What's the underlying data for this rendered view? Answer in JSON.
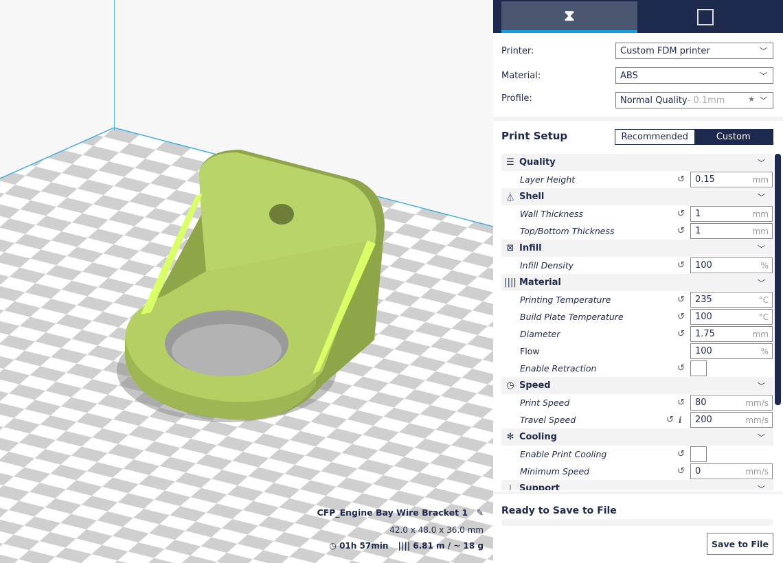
{
  "viewport": {
    "object_name": "CFP_Engine Bay Wire Bracket 1",
    "dimensions": "42.0 x 48.0 x 36.0 mm",
    "print_time": "01h 57min",
    "material_usage": "6.81 m / ~ 18 g",
    "model_color": "#b9d468"
  },
  "tabs": [
    {
      "icon": "slice-settings-icon",
      "active": true
    },
    {
      "icon": "printer-monitor-icon",
      "active": false
    }
  ],
  "machine": {
    "printer_label": "Printer:",
    "printer_value": "Custom FDM printer",
    "material_label": "Material:",
    "material_value": "ABS",
    "profile_label": "Profile:",
    "profile_value": "Normal Quality",
    "profile_suffix": " - 0.1mm"
  },
  "print_setup": {
    "title": "Print Setup",
    "mode_recommended": "Recommended",
    "mode_custom": "Custom",
    "active_mode": "Custom"
  },
  "categories": [
    {
      "label": "Quality",
      "icon": "quality-icon",
      "settings": [
        {
          "label": "Layer Height",
          "value": "0.15",
          "unit": "mm"
        }
      ]
    },
    {
      "label": "Shell",
      "icon": "shell-icon",
      "settings": [
        {
          "label": "Wall Thickness",
          "value": "1",
          "unit": "mm"
        },
        {
          "label": "Top/Bottom Thickness",
          "value": "1",
          "unit": "mm"
        }
      ]
    },
    {
      "label": "Infill",
      "icon": "infill-icon",
      "settings": [
        {
          "label": "Infill Density",
          "value": "100",
          "unit": "%"
        }
      ]
    },
    {
      "label": "Material",
      "icon": "material-icon",
      "settings": [
        {
          "label": "Printing Temperature",
          "value": "235",
          "unit": "°C"
        },
        {
          "label": "Build Plate Temperature",
          "value": "100",
          "unit": "°C"
        },
        {
          "label": "Diameter",
          "value": "1.75",
          "unit": "mm"
        },
        {
          "label": "Flow",
          "value": "100",
          "unit": "%"
        },
        {
          "label": "Enable Retraction",
          "checked": false
        }
      ]
    },
    {
      "label": "Speed",
      "icon": "speed-icon",
      "settings": [
        {
          "label": "Print Speed",
          "value": "80",
          "unit": "mm/s"
        },
        {
          "label": "Travel Speed",
          "value": "200",
          "unit": "mm/s"
        }
      ]
    },
    {
      "label": "Cooling",
      "icon": "cooling-icon",
      "settings": [
        {
          "label": "Enable Print Cooling",
          "checked": false
        },
        {
          "label": "Minimum Speed",
          "value": "0",
          "unit": "mm/s"
        }
      ]
    },
    {
      "label": "Support",
      "icon": "support-icon",
      "settings": []
    }
  ],
  "output": {
    "status": "Ready to Save to File",
    "progress": 0,
    "save_label": "Save to File"
  }
}
